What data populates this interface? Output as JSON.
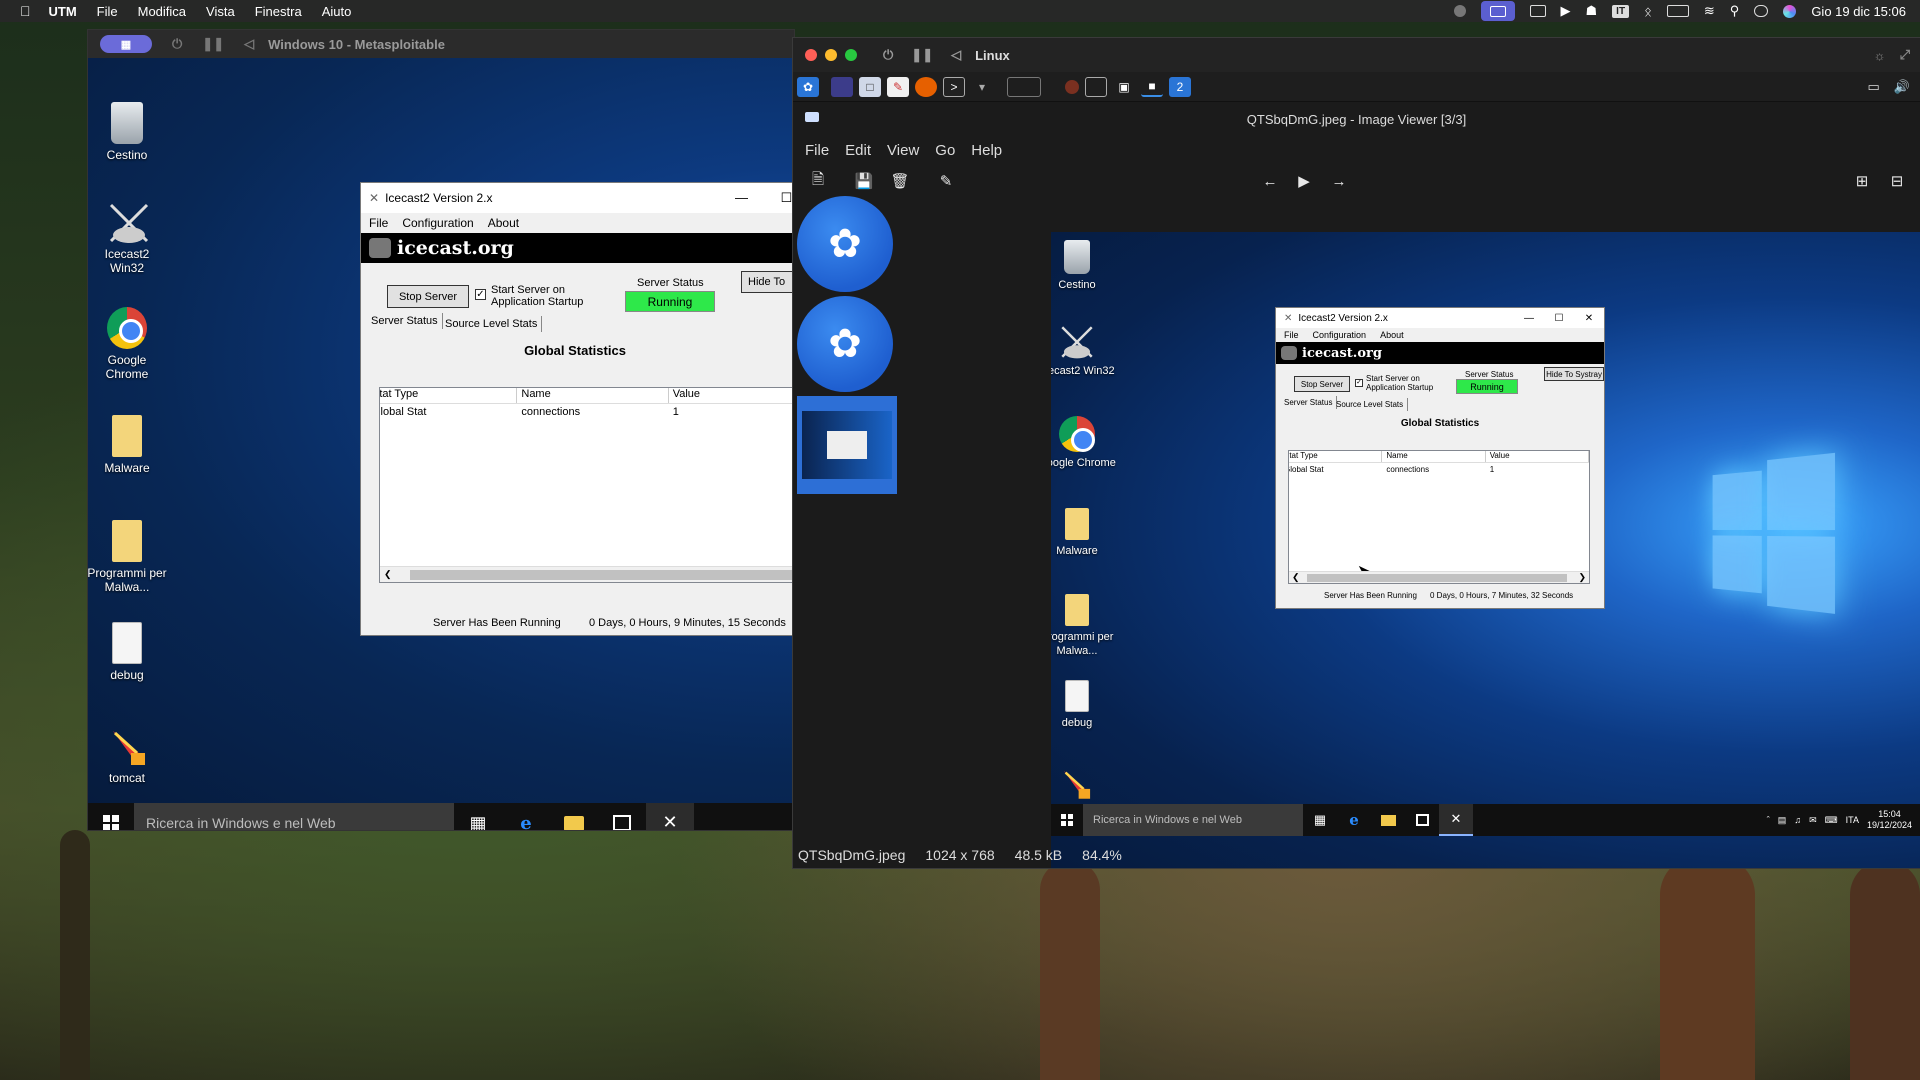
{
  "macbar": {
    "app": "UTM",
    "menus": [
      "File",
      "Modifica",
      "Vista",
      "Finestra",
      "Aiuto"
    ],
    "clock": "Gio 19 dic  15:06",
    "kbd": "IT"
  },
  "win_vm": {
    "title": "Windows 10 - Metasploitable",
    "desktop_icons": [
      {
        "label": "Cestino",
        "icon": "recycle-bin-icon"
      },
      {
        "label": "Icecast2 Win32",
        "icon": "icecast-icon"
      },
      {
        "label": "Google Chrome",
        "icon": "chrome-icon"
      },
      {
        "label": "Malware",
        "icon": "folder-icon"
      },
      {
        "label": "Programmi per Malwa...",
        "icon": "folder-icon"
      },
      {
        "label": "debug",
        "icon": "document-icon"
      },
      {
        "label": "tomcat",
        "icon": "tomcat-icon"
      }
    ],
    "taskbar": {
      "search_placeholder": "Ricerca in Windows e nel Web"
    }
  },
  "icecast": {
    "title": "Icecast2 Version 2.x",
    "menu": [
      "File",
      "Configuration",
      "About"
    ],
    "banner": "icecast.org",
    "stop_button": "Stop Server",
    "startup_label": "Start Server on Application Startup",
    "status_label": "Server Status",
    "status_value": "Running",
    "hide_button_cut": "Hide To",
    "hide_button": "Hide To Systray",
    "tabs": [
      "Server Status",
      "Source Level Stats"
    ],
    "heading": "Global Statistics",
    "columns": [
      "Stat Type",
      "Name",
      "Value"
    ],
    "rows": [
      [
        "Global Stat",
        "connections",
        "1"
      ]
    ],
    "running_label": "Server Has Been Running",
    "uptime_left": "0 Days, 0 Hours, 9 Minutes, 15 Seconds",
    "uptime_right": "0 Days, 0 Hours, 7 Minutes, 32 Seconds"
  },
  "linux": {
    "title": "Linux",
    "app_title": "QTSbqDmG.jpeg - Image Viewer [3/3]",
    "menu": [
      "File",
      "Edit",
      "View",
      "Go",
      "Help"
    ],
    "status": {
      "filename": "QTSbqDmG.jpeg",
      "dimensions": "1024 x 768",
      "size": "48.5 kB",
      "zoom": "84.4%"
    },
    "viewer_taskbar": {
      "search_placeholder": "Ricerca in Windows e nel Web",
      "lang": "ITA",
      "time": "15:04",
      "date": "19/12/2024"
    }
  }
}
